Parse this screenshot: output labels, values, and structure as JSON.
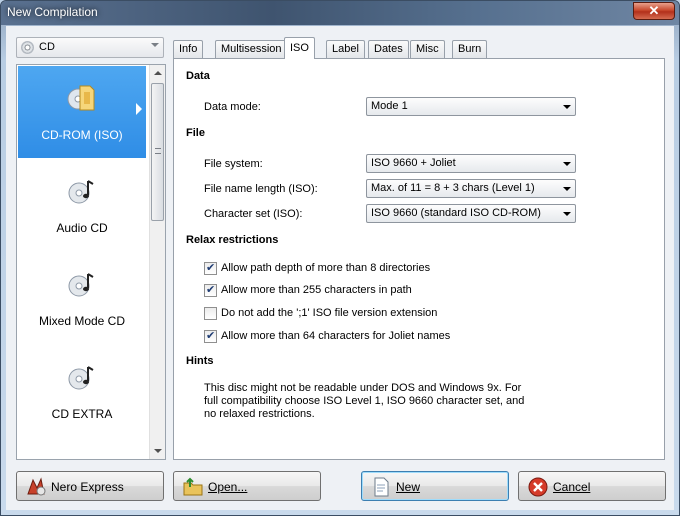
{
  "window": {
    "title": "New Compilation",
    "close_glyph": "✕"
  },
  "media": {
    "selected": "CD"
  },
  "types": [
    {
      "label": "CD-ROM (ISO)",
      "icon": "cd-rom-iso-icon",
      "selected": true
    },
    {
      "label": "Audio CD",
      "icon": "audio-cd-icon",
      "selected": false
    },
    {
      "label": "Mixed Mode CD",
      "icon": "mixed-mode-cd-icon",
      "selected": false
    },
    {
      "label": "CD EXTRA",
      "icon": "cd-extra-icon",
      "selected": false
    }
  ],
  "tabs": [
    "Info",
    "Multisession",
    "ISO",
    "Label",
    "Dates",
    "Misc",
    "Burn"
  ],
  "active_tab": "ISO",
  "iso": {
    "data_section": "Data",
    "data_mode_label": "Data mode:",
    "data_mode_value": "Mode 1",
    "file_section": "File",
    "file_system_label": "File system:",
    "file_system_value": "ISO 9660 + Joliet",
    "name_length_label": "File name length (ISO):",
    "name_length_value": "Max. of 11 = 8 + 3 chars (Level 1)",
    "charset_label": "Character set (ISO):",
    "charset_value": "ISO 9660 (standard ISO CD-ROM)",
    "relax_section": "Relax restrictions",
    "relax": [
      {
        "label": "Allow path depth of more than 8 directories",
        "checked": true
      },
      {
        "label": "Allow more than 255 characters in path",
        "checked": true
      },
      {
        "label": "Do not add the ';1' ISO file version extension",
        "checked": false
      },
      {
        "label": "Allow more than 64 characters for Joliet names",
        "checked": true
      }
    ],
    "hints_section": "Hints",
    "hints_text": "This disc might not be readable under DOS and Windows 9x. For full compatibility choose ISO Level 1, ISO 9660 character set, and no relaxed restrictions."
  },
  "buttons": {
    "nero_express": "Nero Express",
    "open": "Open...",
    "new": "New",
    "cancel": "Cancel"
  },
  "colors": {
    "selection": "#3d97ea",
    "title_bar": "#4a6181"
  }
}
